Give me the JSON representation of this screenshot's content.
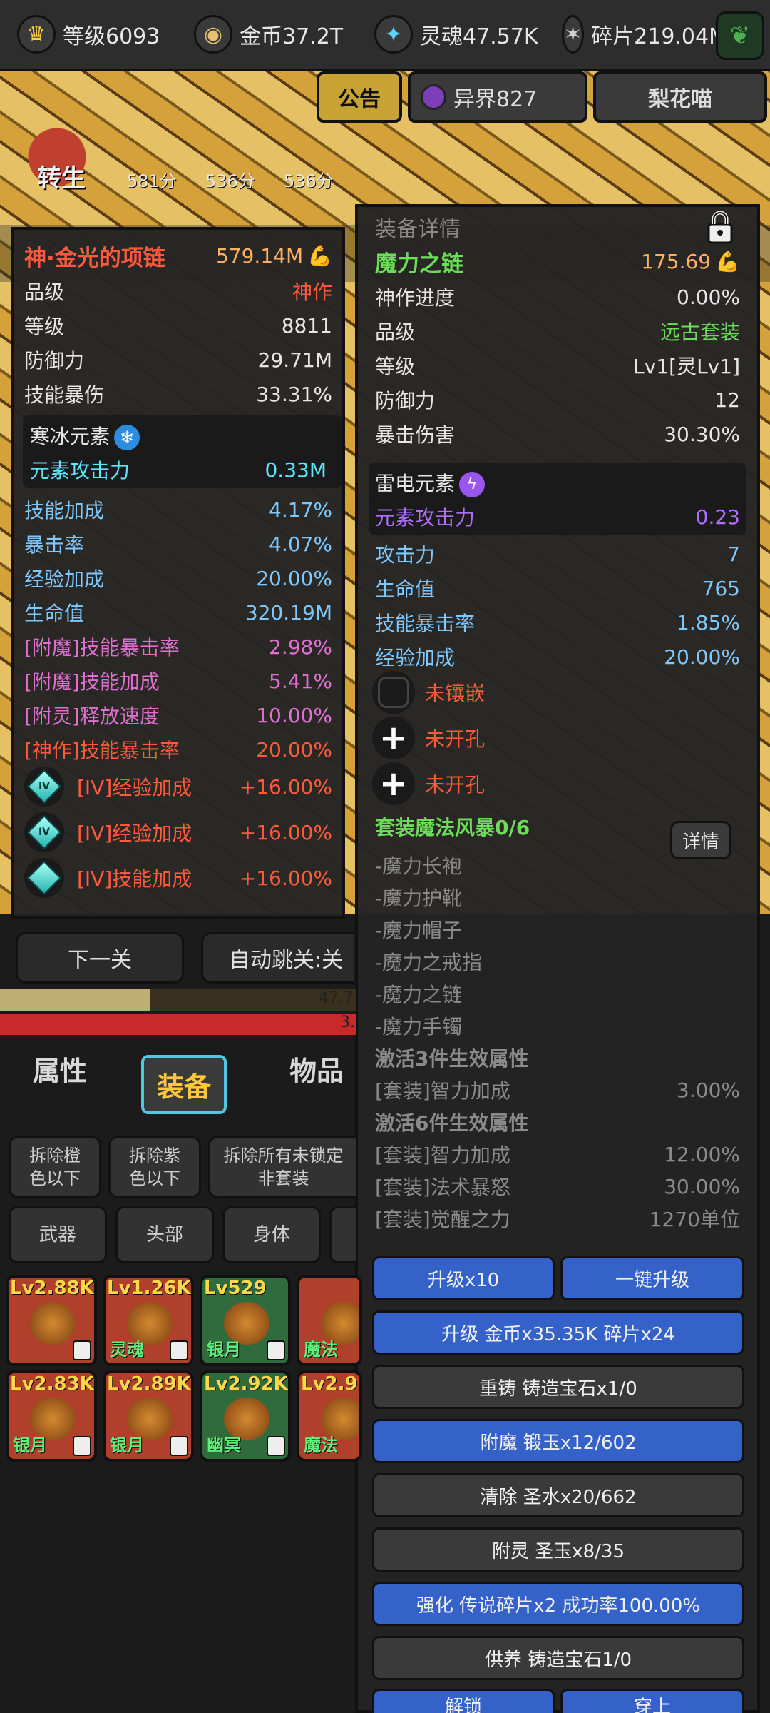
{
  "resources": [
    {
      "icon": "crown-icon",
      "glyph": "♛",
      "label": "等级6093"
    },
    {
      "icon": "coin-icon",
      "glyph": "◉",
      "label": "金币37.2T"
    },
    {
      "icon": "soul-icon",
      "glyph": "✦",
      "label": "灵魂47.57K"
    },
    {
      "icon": "shard-icon",
      "glyph": "✶",
      "label": "碎片219.04M"
    }
  ],
  "header_tabs": {
    "notice": "公告",
    "otherworld": "异界827",
    "cat": "梨花喵"
  },
  "scene": {
    "rebirth": "转生",
    "scores": [
      "581分",
      "536分",
      "536分"
    ]
  },
  "left_item": {
    "name": "神·金光的项链",
    "power": "579.14M",
    "stats": [
      {
        "label": "品级",
        "value": "神作",
        "cls": "c-red"
      },
      {
        "label": "等级",
        "value": "8811",
        "cls": ""
      },
      {
        "label": "防御力",
        "value": "29.71M",
        "cls": ""
      },
      {
        "label": "技能暴伤",
        "value": "33.31%",
        "cls": ""
      }
    ],
    "element": {
      "name": "寒冰元素",
      "attack_label": "元素攻击力",
      "attack_value": "0.33M"
    },
    "bonus": [
      {
        "label": "技能加成",
        "value": "4.17%",
        "cls": "c-blue"
      },
      {
        "label": "暴击率",
        "value": "4.07%",
        "cls": "c-blue"
      },
      {
        "label": "经验加成",
        "value": "20.00%",
        "cls": "c-blue"
      },
      {
        "label": "生命值",
        "value": "320.19M",
        "cls": "c-blue"
      },
      {
        "label": "[附魔]技能暴击率",
        "value": "2.98%",
        "cls": "c-pink"
      },
      {
        "label": "[附魔]技能加成",
        "value": "5.41%",
        "cls": "c-pink"
      },
      {
        "label": "[附灵]释放速度",
        "value": "10.00%",
        "cls": "c-pink"
      },
      {
        "label": "[神作]技能暴击率",
        "value": "20.00%",
        "cls": "c-red"
      }
    ],
    "gems": [
      {
        "label": "[IV]经验加成",
        "value": "+16.00%",
        "mark": "IV"
      },
      {
        "label": "[IV]经验加成",
        "value": "+16.00%",
        "mark": "IV"
      },
      {
        "label": "[IV]技能加成",
        "value": "+16.00%",
        "mark": ""
      }
    ]
  },
  "detail": {
    "title": "装备详情",
    "name": "魔力之链",
    "power": "175.69",
    "stats": [
      {
        "label": "神作进度",
        "value": "0.00%",
        "cls": ""
      },
      {
        "label": "品级",
        "value": "远古套装",
        "cls": "c-green"
      },
      {
        "label": "等级",
        "value": "Lv1[灵Lv1]",
        "cls": ""
      },
      {
        "label": "防御力",
        "value": "12",
        "cls": ""
      },
      {
        "label": "暴击伤害",
        "value": "30.30%",
        "cls": ""
      }
    ],
    "element": {
      "name": "雷电元素",
      "attack_label": "元素攻击力",
      "attack_value": "0.23"
    },
    "bonus": [
      {
        "label": "攻击力",
        "value": "7"
      },
      {
        "label": "生命值",
        "value": "765"
      },
      {
        "label": "技能暴击率",
        "value": "1.85%"
      },
      {
        "label": "经验加成",
        "value": "20.00%"
      }
    ],
    "sockets": [
      {
        "type": "empty",
        "label": "未镶嵌"
      },
      {
        "type": "plus",
        "label": "未开孔"
      },
      {
        "type": "plus",
        "label": "未开孔"
      }
    ],
    "set_title": "套装魔法风暴0/6",
    "detail_btn": "详情",
    "set_parts": [
      "-魔力长袍",
      "-魔力护靴",
      "-魔力帽子",
      "-魔力之戒指",
      "-魔力之链",
      "-魔力手镯"
    ],
    "set3_title": "激活3件生效属性",
    "set3": [
      {
        "label": "[套装]智力加成",
        "value": "3.00%"
      }
    ],
    "set6_title": "激活6件生效属性",
    "set6": [
      {
        "label": "[套装]智力加成",
        "value": "12.00%"
      },
      {
        "label": "[套装]法术暴怒",
        "value": "30.00%"
      },
      {
        "label": "[套装]觉醒之力",
        "value": "1270单位"
      }
    ],
    "actions": {
      "upgrade10": "升级x10",
      "one_key": "一键升级",
      "upgrade_cost": "升级 金币x35.35K 碎片x24",
      "recast": "重铸 铸造宝石x1/0",
      "enchant": "附魔 锻玉x12/602",
      "clear": "清除 圣水x20/662",
      "spirit": "附灵 圣玉x8/35",
      "enhance": "强化 传说碎片x2 成功率100.00%",
      "offer": "供养 铸造宝石1/0",
      "unlock": "解锁",
      "wear": "穿上"
    }
  },
  "controls": {
    "next": "下一关",
    "auto": "自动跳关:关",
    "bar1_text": "47.7",
    "bar2_text": "3.",
    "xp_progress": 0.42
  },
  "main_tabs": {
    "attr": "属性",
    "equip": "装备",
    "items": "物品"
  },
  "filters": [
    "拆除橙色以下",
    "拆除紫色以下",
    "拆除所有未锁定非套装"
  ],
  "categories": [
    "武器",
    "头部",
    "身体"
  ],
  "inventory": [
    {
      "lv": "Lv2.88K",
      "name": "",
      "color": "red"
    },
    {
      "lv": "Lv1.26K",
      "name": "灵魂",
      "color": "red"
    },
    {
      "lv": "Lv529",
      "name": "银月",
      "color": "green"
    },
    {
      "lv": "",
      "name": "魔法",
      "color": "red"
    },
    {
      "lv": "Lv2.83K",
      "name": "银月",
      "color": "red"
    },
    {
      "lv": "Lv2.89K",
      "name": "银月",
      "color": "red"
    },
    {
      "lv": "Lv2.92K",
      "name": "幽冥",
      "color": "green"
    },
    {
      "lv": "Lv2.9",
      "name": "魔法",
      "color": "red"
    }
  ]
}
